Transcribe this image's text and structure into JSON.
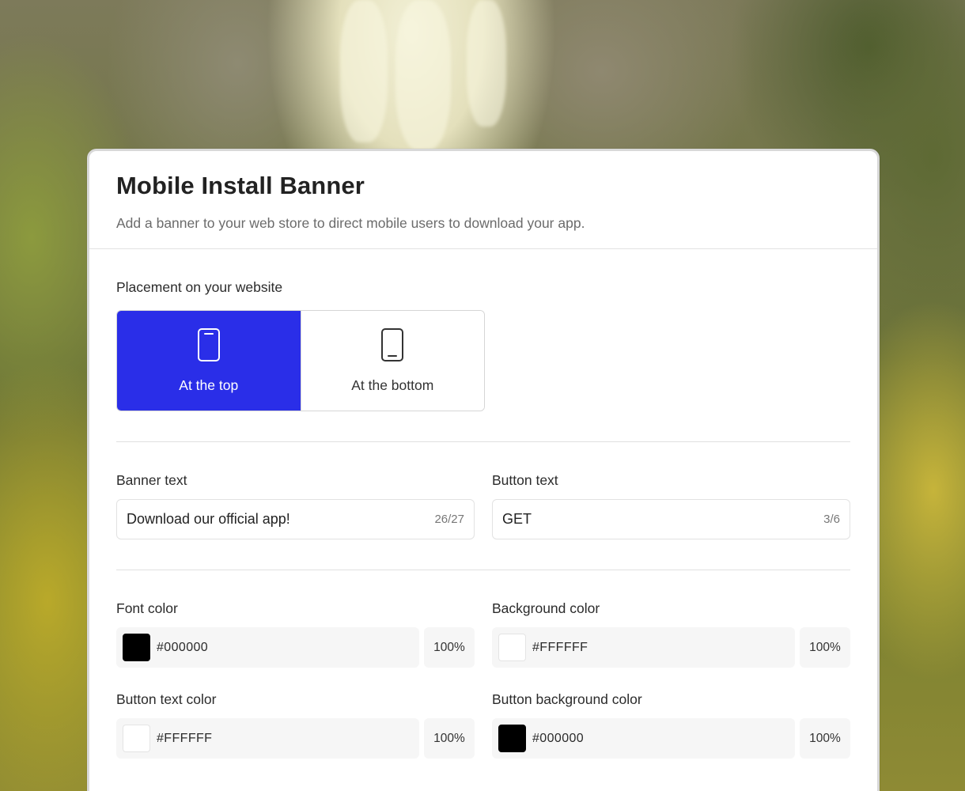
{
  "header": {
    "title": "Mobile Install Banner",
    "subtitle": "Add a banner to your web store to direct mobile users to download your app."
  },
  "placement": {
    "label": "Placement on your website",
    "options": [
      {
        "label": "At the top",
        "selected": true,
        "icon": "phone-top-icon"
      },
      {
        "label": "At the bottom",
        "selected": false,
        "icon": "phone-bottom-icon"
      }
    ],
    "accent_color": "#2A2EE8"
  },
  "banner_text": {
    "label": "Banner text",
    "value": "Download our official app!",
    "counter": "26/27"
  },
  "button_text": {
    "label": "Button text",
    "value": "GET",
    "counter": "3/6"
  },
  "colors": {
    "font_color": {
      "label": "Font color",
      "hex": "#000000",
      "opacity": "100%"
    },
    "background_color": {
      "label": "Background color",
      "hex": "#FFFFFF",
      "opacity": "100%"
    },
    "button_text_color": {
      "label": "Button text color",
      "hex": "#FFFFFF",
      "opacity": "100%"
    },
    "button_background_color": {
      "label": "Button background color",
      "hex": "#000000",
      "opacity": "100%"
    }
  }
}
